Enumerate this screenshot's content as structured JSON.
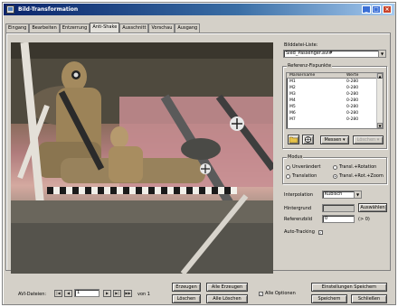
{
  "window": {
    "title": "Bild-Transformation"
  },
  "tabs": [
    "Eingang",
    "Bearbeiten",
    "Entzerrung",
    "Anti-Shake",
    "Ausschnitt",
    "Vorschau",
    "Ausgang"
  ],
  "active_tab": "Anti-Shake",
  "right": {
    "file_list_label": "Bilddatei-Liste:",
    "file_selected": "Sled_Passenger.avi#",
    "ref_group_title": "Referenz-Fixpunkte",
    "columns": [
      "Markername",
      "Werte"
    ],
    "markers": [
      {
        "name": "M1",
        "value": "0-280"
      },
      {
        "name": "M2",
        "value": "0-280"
      },
      {
        "name": "M3",
        "value": "0-280"
      },
      {
        "name": "M4",
        "value": "0-280"
      },
      {
        "name": "M5",
        "value": "0-280"
      },
      {
        "name": "M6",
        "value": "0-280"
      },
      {
        "name": "M7",
        "value": "0-280"
      }
    ],
    "measure_btn": "Messen",
    "delete_btn": "Löschen",
    "mode_group_title": "Modus",
    "mode_options": [
      "Unverändert",
      "Transl.+Rotation",
      "Translation",
      "Transl.+Rot.+Zoom"
    ],
    "mode_selected": "Transl.+Rot.+Zoom",
    "interp_label": "Interpolation",
    "interp_value": "Kubisch",
    "background_label": "Hintergrund",
    "background_btn": "Auswählen",
    "reference_label": "Referenzbild",
    "reference_value": "0",
    "reference_range": "(> 0)",
    "auto_tracking_label": "Auto-Tracking"
  },
  "bottom": {
    "avi_label": "AVI-Dateien:",
    "frame_value": "1",
    "of_label": "von 1",
    "create_btn": "Erzeugen",
    "delete_btn": "Löschen",
    "all_create_btn": "Alle Erzeugen",
    "all_delete_btn": "Alle Löschen",
    "all_options_label": "Alle Optionen",
    "save_settings_btn": "Einstellungen Speichern",
    "save_btn": "Speichern",
    "close_btn": "Schließen"
  }
}
